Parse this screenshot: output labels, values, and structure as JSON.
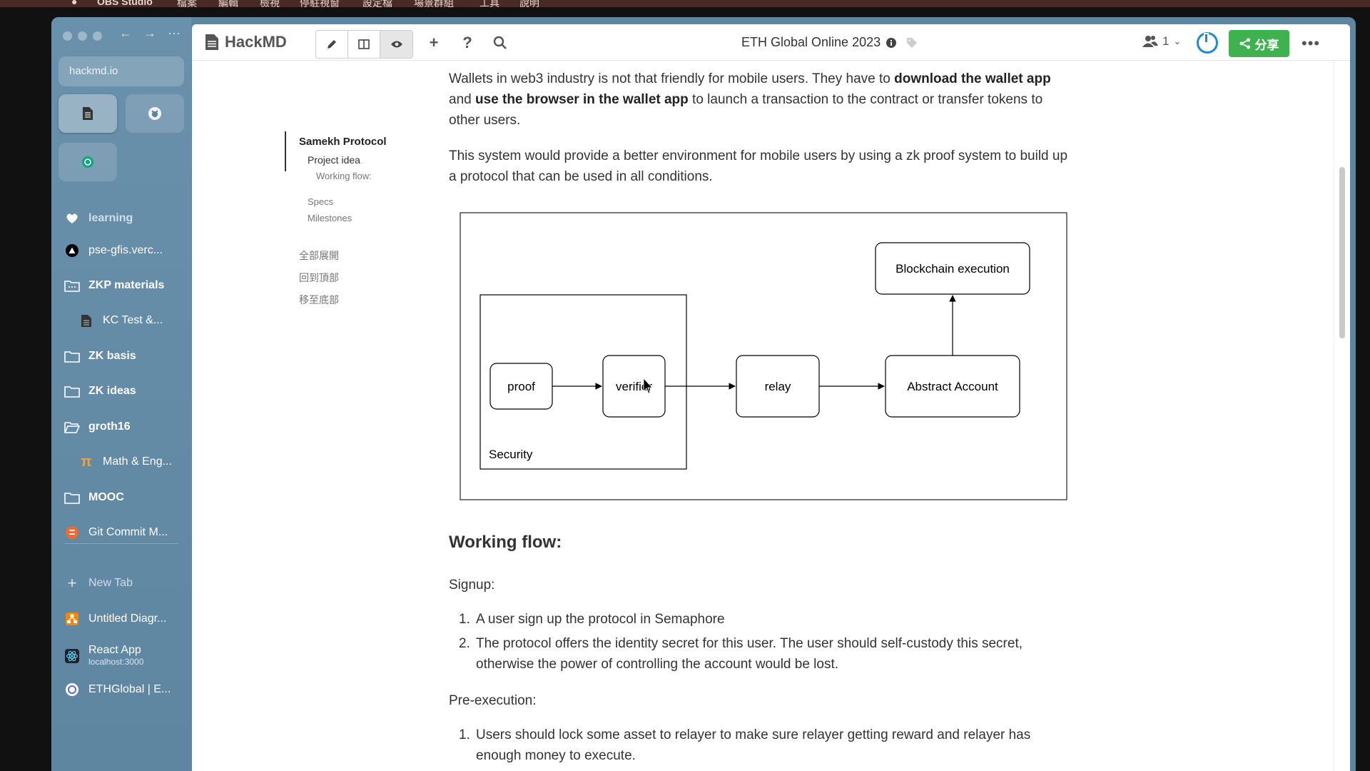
{
  "menubar": {
    "app_name": "OBS Studio",
    "items": [
      "檔案",
      "編輯",
      "檢視",
      "停駐視窗",
      "設定檔",
      "場景群組",
      "工具",
      "說明"
    ]
  },
  "sidebar": {
    "url": "hackmd.io",
    "items": [
      {
        "label": "learning",
        "icon": "heart-icon",
        "style": "muted"
      },
      {
        "label": "pse-gfis.verc...",
        "icon": "vercel-icon",
        "style": "normal"
      },
      {
        "label": "ZKP materials",
        "icon": "folder-icon",
        "style": "bold"
      },
      {
        "label": "KC Test &...",
        "icon": "document-icon",
        "style": "sub"
      },
      {
        "label": "ZK basis",
        "icon": "folder-icon",
        "style": "bold"
      },
      {
        "label": "ZK ideas",
        "icon": "folder-icon",
        "style": "bold"
      },
      {
        "label": "groth16",
        "icon": "folder-open-icon",
        "style": "bold"
      },
      {
        "label": "Math & Eng...",
        "icon": "pi-icon",
        "style": "sub"
      },
      {
        "label": "MOOC",
        "icon": "folder-icon",
        "style": "bold"
      },
      {
        "label": "Git Commit M...",
        "icon": "blogger-icon",
        "style": "normal"
      }
    ],
    "new_tab_label": "New Tab",
    "tabs": [
      {
        "label": "Untitled Diagr...",
        "icon": "drawio-icon"
      },
      {
        "label": "React App",
        "sub": "localhost:3000",
        "icon": "react-icon"
      },
      {
        "label": "ETHGlobal | E...",
        "icon": "ethglobal-icon"
      }
    ]
  },
  "topbar": {
    "brand": "HackMD",
    "doc_title": "ETH Global Online 2023",
    "online_count": "1",
    "share_label": "分享"
  },
  "toc": {
    "items": [
      {
        "label": "Samekh Protocol",
        "level": "active"
      },
      {
        "label": "Project idea",
        "level": "cur"
      },
      {
        "label": "Working flow:",
        "level": "sub"
      },
      {
        "label": "Specs",
        "level": "small"
      },
      {
        "label": "Milestones",
        "level": "small"
      }
    ],
    "actions": [
      "全部展開",
      "回到頂部",
      "移至底部"
    ]
  },
  "content": {
    "para1": {
      "a": "Wallets in web3 industry is not that friendly for mobile users. They have to ",
      "b1": "download the wallet app",
      "c": " and ",
      "b2": "use the browser in the wallet app",
      "d": " to launch a transaction to the contract or transfer tokens to other users."
    },
    "para2": "This system would provide a better environment for mobile users by using a zk proof system to build up a protocol that can be used in all conditions.",
    "diagram": {
      "nodes": {
        "proof": "proof",
        "verifier": "verifier",
        "relay": "relay",
        "abstract": "Abstract Account",
        "blockchain": "Blockchain execution",
        "security": "Security"
      }
    },
    "working_flow_heading": "Working flow:",
    "signup_label": "Signup:",
    "signup_steps": [
      "A user sign up the protocol in Semaphore",
      "The protocol offers the identity secret for this user. The user should self-custody this secret, otherwise the power of controlling the account would be lost."
    ],
    "preexec_label": "Pre-execution:",
    "preexec_steps": [
      "Users should lock some asset to relayer to make sure relayer getting reward and relayer has enough money to execute."
    ]
  }
}
